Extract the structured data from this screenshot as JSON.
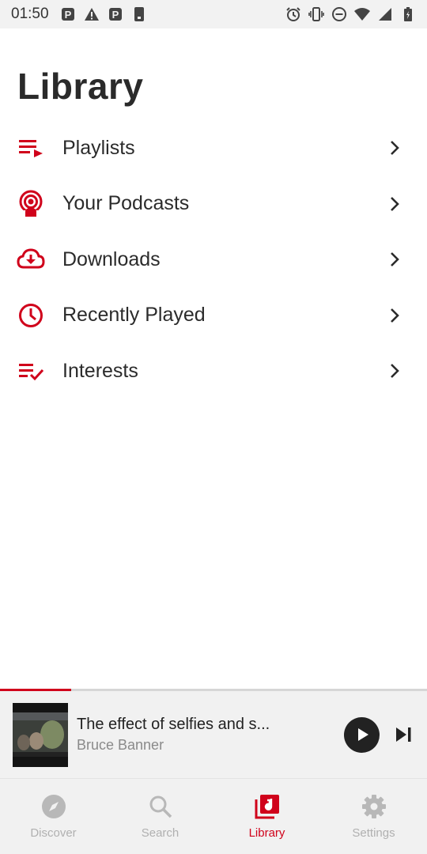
{
  "status_bar": {
    "time": "01:50",
    "left_icons": [
      "parking-icon",
      "warning-icon",
      "parking-icon",
      "phone-icon"
    ],
    "right_icons": [
      "alarm-icon",
      "vibrate-icon",
      "do-not-disturb-icon",
      "wifi-icon",
      "signal-icon",
      "battery-icon"
    ]
  },
  "page": {
    "title": "Library"
  },
  "menu": {
    "items": [
      {
        "label": "Playlists",
        "icon": "playlist-icon"
      },
      {
        "label": "Your Podcasts",
        "icon": "podcast-icon"
      },
      {
        "label": "Downloads",
        "icon": "cloud-download-icon"
      },
      {
        "label": "Recently Played",
        "icon": "clock-icon"
      },
      {
        "label": "Interests",
        "icon": "checklist-icon"
      }
    ]
  },
  "player": {
    "title": "The effect of selfies and s...",
    "artist": "Bruce Banner",
    "progress": 0.167
  },
  "nav": {
    "items": [
      {
        "label": "Discover",
        "icon": "compass-icon"
      },
      {
        "label": "Search",
        "icon": "search-icon"
      },
      {
        "label": "Library",
        "icon": "library-music-icon",
        "active": true
      },
      {
        "label": "Settings",
        "icon": "gear-icon"
      }
    ]
  },
  "colors": {
    "accent": "#d0021b",
    "inactive": "#b0b0b0",
    "text": "#2b2b2b"
  }
}
